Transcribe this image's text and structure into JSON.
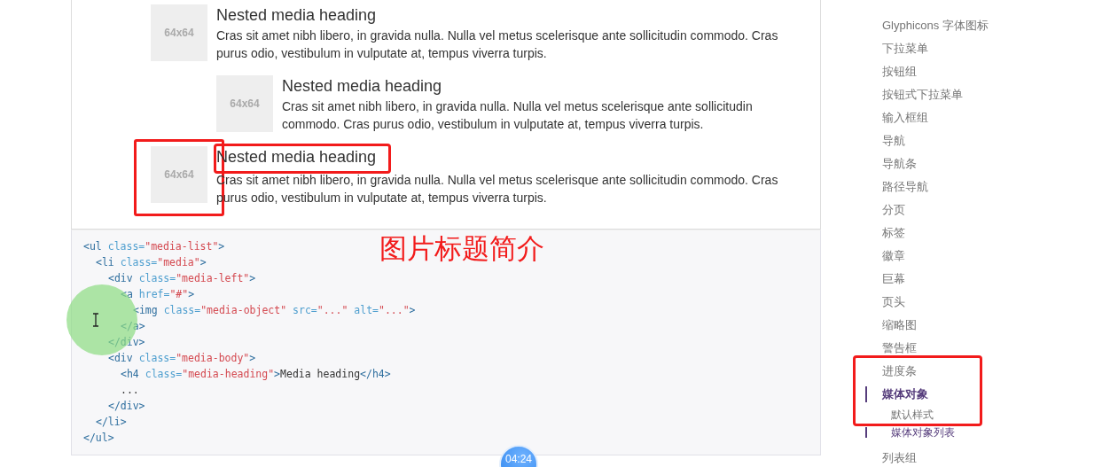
{
  "media_items": [
    {
      "image_label": "64x64",
      "heading": "Nested media heading",
      "text": "Cras sit amet nibh libero, in gravida nulla. Nulla vel metus scelerisque ante sollicitudin commodo. Cras purus odio, vestibulum in vulputate at, tempus viverra turpis.",
      "highlighted": false,
      "children": [
        {
          "image_label": "64x64",
          "heading": "Nested media heading",
          "text": "Cras sit amet nibh libero, in gravida nulla. Nulla vel metus scelerisque ante sollicitudin commodo. Cras purus odio, vestibulum in vulputate at, tempus viverra turpis.",
          "highlighted": false
        }
      ]
    },
    {
      "image_label": "64x64",
      "heading": "Nested media heading",
      "text": "Cras sit amet nibh libero, in gravida nulla. Nulla vel metus scelerisque ante sollicitudin commodo. Cras purus odio, vestibulum in vulputate at, tempus viverra turpis.",
      "highlighted": true
    }
  ],
  "annotation": "图片标题简介",
  "code_lines": [
    {
      "tokens": [
        {
          "kind": "tag",
          "text": "<ul"
        },
        {
          "kind": "attr",
          "text": " class="
        },
        {
          "kind": "value",
          "text": "\"media-list\""
        },
        {
          "kind": "tag",
          "text": ">"
        }
      ],
      "children": [
        {
          "tokens": [
            {
              "kind": "tag",
              "text": "<li"
            },
            {
              "kind": "attr",
              "text": " class="
            },
            {
              "kind": "value",
              "text": "\"media\""
            },
            {
              "kind": "tag",
              "text": ">"
            }
          ],
          "children": [
            {
              "tokens": [
                {
                  "kind": "tag",
                  "text": "<div"
                },
                {
                  "kind": "attr",
                  "text": " class="
                },
                {
                  "kind": "value",
                  "text": "\"media-left\""
                },
                {
                  "kind": "tag",
                  "text": ">"
                }
              ],
              "children": [
                {
                  "tokens": [
                    {
                      "kind": "tag",
                      "text": "<a"
                    },
                    {
                      "kind": "attr",
                      "text": " href="
                    },
                    {
                      "kind": "value",
                      "text": "\"#\""
                    },
                    {
                      "kind": "tag",
                      "text": ">"
                    }
                  ],
                  "children": [
                    {
                      "tokens": [
                        {
                          "kind": "tag",
                          "text": "<img"
                        },
                        {
                          "kind": "attr",
                          "text": " class="
                        },
                        {
                          "kind": "value",
                          "text": "\"media-object\""
                        },
                        {
                          "kind": "attr",
                          "text": " src="
                        },
                        {
                          "kind": "value",
                          "text": "\"...\""
                        },
                        {
                          "kind": "attr",
                          "text": " alt="
                        },
                        {
                          "kind": "value",
                          "text": "\"...\""
                        },
                        {
                          "kind": "tag",
                          "text": ">"
                        }
                      ]
                    }
                  ]
                },
                {
                  "tokens": [
                    {
                      "kind": "tag",
                      "text": "</a>"
                    }
                  ]
                }
              ]
            },
            {
              "tokens": [
                {
                  "kind": "tag",
                  "text": "</div>"
                }
              ]
            },
            {
              "tokens": [
                {
                  "kind": "tag",
                  "text": "<div"
                },
                {
                  "kind": "attr",
                  "text": " class="
                },
                {
                  "kind": "value",
                  "text": "\"media-body\""
                },
                {
                  "kind": "tag",
                  "text": ">"
                }
              ],
              "children": [
                {
                  "tokens": [
                    {
                      "kind": "tag",
                      "text": "<h4"
                    },
                    {
                      "kind": "attr",
                      "text": " class="
                    },
                    {
                      "kind": "value",
                      "text": "\"media-heading\""
                    },
                    {
                      "kind": "tag",
                      "text": ">"
                    },
                    {
                      "kind": "text",
                      "text": "Media heading"
                    },
                    {
                      "kind": "tag",
                      "text": "</h4>"
                    }
                  ]
                },
                {
                  "tokens": [
                    {
                      "kind": "text",
                      "text": "..."
                    }
                  ]
                }
              ]
            },
            {
              "tokens": [
                {
                  "kind": "tag",
                  "text": "</div>"
                }
              ]
            }
          ]
        },
        {
          "tokens": [
            {
              "kind": "tag",
              "text": "</li>"
            }
          ]
        }
      ]
    },
    {
      "tokens": [
        {
          "kind": "tag",
          "text": "</ul>"
        }
      ]
    }
  ],
  "sidebar": {
    "items": [
      {
        "label": "Glyphicons 字体图标",
        "selected": false,
        "highlighted": false
      },
      {
        "label": "下拉菜单",
        "selected": false,
        "highlighted": false
      },
      {
        "label": "按钮组",
        "selected": false,
        "highlighted": false
      },
      {
        "label": "按钮式下拉菜单",
        "selected": false,
        "highlighted": false
      },
      {
        "label": "输入框组",
        "selected": false,
        "highlighted": false
      },
      {
        "label": "导航",
        "selected": false,
        "highlighted": false
      },
      {
        "label": "导航条",
        "selected": false,
        "highlighted": false
      },
      {
        "label": "路径导航",
        "selected": false,
        "highlighted": false
      },
      {
        "label": "分页",
        "selected": false,
        "highlighted": false
      },
      {
        "label": "标签",
        "selected": false,
        "highlighted": false
      },
      {
        "label": "徽章",
        "selected": false,
        "highlighted": false
      },
      {
        "label": "巨幕",
        "selected": false,
        "highlighted": false
      },
      {
        "label": "页头",
        "selected": false,
        "highlighted": false
      },
      {
        "label": "缩略图",
        "selected": false,
        "highlighted": false
      },
      {
        "label": "警告框",
        "selected": false,
        "highlighted": false
      },
      {
        "label": "进度条",
        "selected": false,
        "highlighted": true
      },
      {
        "label": "媒体对象",
        "selected": true,
        "highlighted": true,
        "children": [
          {
            "label": "默认样式",
            "selected": false
          },
          {
            "label": "媒体对象列表",
            "selected": true
          }
        ]
      },
      {
        "label": "列表组",
        "selected": false,
        "highlighted": false
      }
    ]
  },
  "timer": "04:24"
}
